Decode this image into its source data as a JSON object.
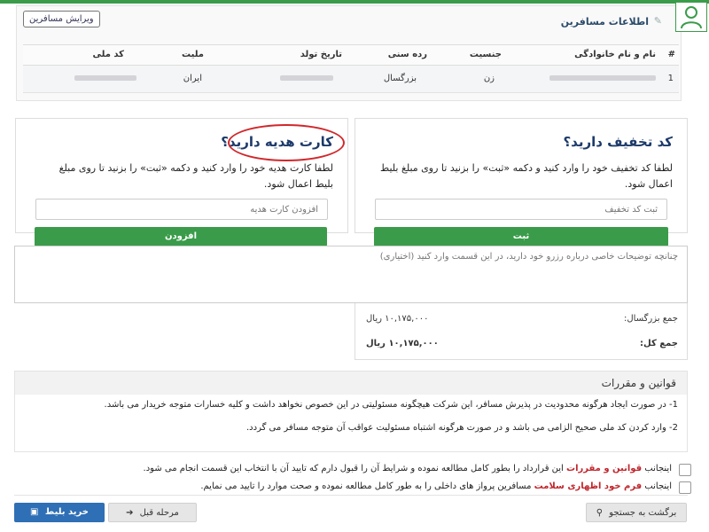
{
  "passengers": {
    "title": "اطلاعات مسافرین",
    "edit_label": "ویرایش مسافرین",
    "columns": [
      "#",
      "نام و نام خانوادگی",
      "جنسیت",
      "رده سنی",
      "تاریخ تولد",
      "ملیت",
      "کد ملی"
    ],
    "rows": [
      {
        "index": "1",
        "name": "",
        "gender": "زن",
        "age_group": "بزرگسال",
        "birth_date": "",
        "nationality": "ایران",
        "national_id": ""
      }
    ]
  },
  "discount": {
    "title": "کد تخفیف دارید؟",
    "description": "لطفا کد تخفیف خود را وارد کنید و دکمه «ثبت» را بزنید تا روی مبلغ بلیط اعمال شود.",
    "placeholder": "ثبت کد تخفیف",
    "button": "ثبت"
  },
  "gift_card": {
    "title": "کارت هدیه دارید؟",
    "description": "لطفا کارت هدیه خود را وارد کنید و دکمه «ثبت» را بزنید تا روی مبلغ بلیط اعمال شود.",
    "placeholder": "افزودن کارت هدیه",
    "button": "افزودن"
  },
  "notes_placeholder": "چنانچه توضیحات خاصی درباره رزرو خود دارید، در این قسمت وارد کنید (اختیاری)",
  "totals": {
    "adult_label": "جمع بزرگسال:",
    "adult_value": "۱۰,۱۷۵,۰۰۰ ریال",
    "total_label": "جمع کل:",
    "total_value": "۱۰,۱۷۵,۰۰۰ ریال"
  },
  "rules": {
    "title": "قوانین و مقررات",
    "items": [
      "1- در صورت ایجاد هرگونه محدودیت در پذیرش مسافر، این شرکت هیچگونه مسئولیتی در این خصوص نخواهد داشت و کلیه خسارات متوجه خریدار می باشد.",
      "2- وارد کردن کد ملی صحیح الزامی می باشد و در صورت هرگونه اشتباه مسئولیت عواقب آن متوجه مسافر می گردد."
    ]
  },
  "agreements": [
    {
      "before": "اینجانب ",
      "link": "قوانین و مقررات",
      "after": " این قرارداد را بطور کامل مطالعه نموده و شرایط آن را قبول دارم که تایید آن با انتخاب این قسمت انجام می شود."
    },
    {
      "before": "اینجانب ",
      "link": "فرم خود اظهاری سلامت",
      "after": " مسافرین پرواز های داخلی را به طور کامل مطالعه نموده و صحت موارد را تایید می نمایم."
    }
  ],
  "buttons": {
    "buy": "خرید بلیط",
    "previous": "مرحله قبل",
    "back": "برگشت به جستجو"
  },
  "colors": {
    "accent_green": "#3a9c4a",
    "primary_blue": "#2f6fb5",
    "highlight_red": "#d0282c"
  }
}
